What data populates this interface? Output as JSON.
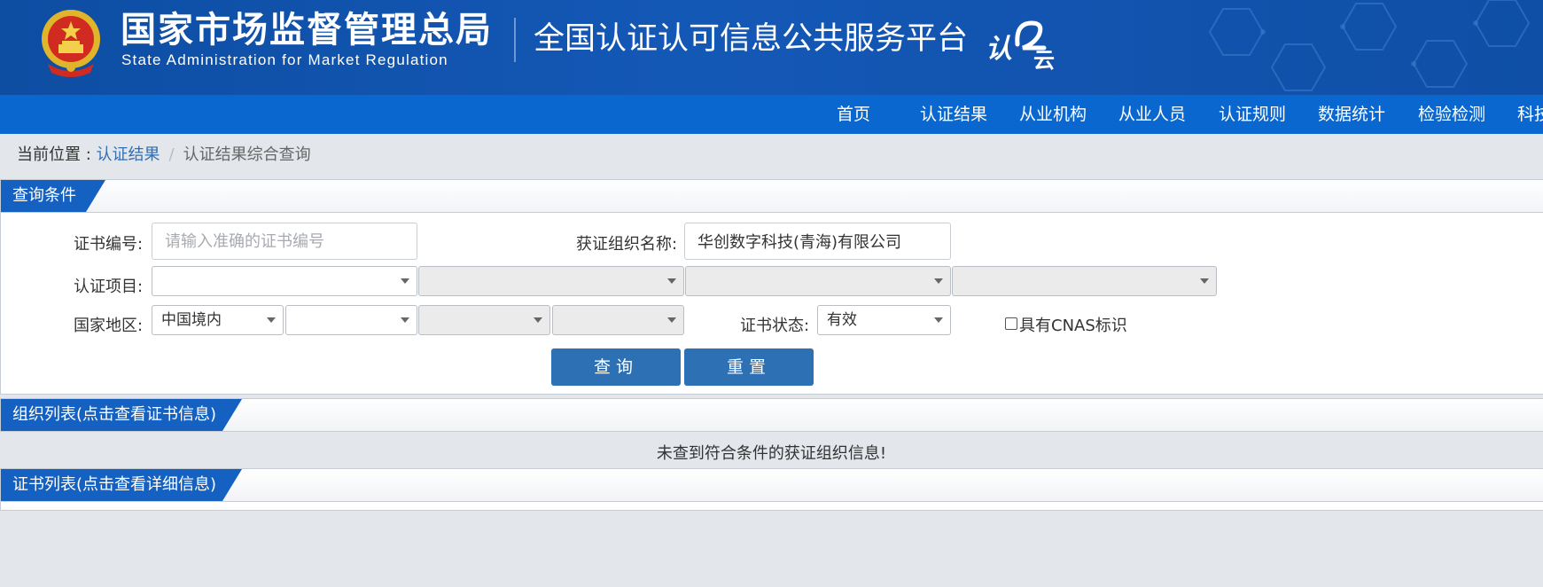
{
  "header": {
    "agency_cn": "国家市场监督管理总局",
    "agency_en": "State Administration  for  Market Regulation",
    "platform_title": "全国认证认可信息公共服务平台",
    "logo_text_main": "认",
    "logo_text_sub": "云",
    "colors": {
      "banner": "#1458b6",
      "nav": "#0a67cf",
      "tab": "#1561c1",
      "button": "#2d70b4",
      "link": "#2e6fb7"
    },
    "emblem_icon": "national-emblem"
  },
  "nav": {
    "items": [
      "首页",
      "认证结果",
      "从业机构",
      "从业人员",
      "认证规则",
      "数据统计",
      "检验检测",
      "科技"
    ]
  },
  "breadcrumb": {
    "prefix": "当前位置 : ",
    "link": "认证结果",
    "separator": "/",
    "current": "认证结果综合查询"
  },
  "query": {
    "section_title": "查询条件",
    "cert_no": {
      "label": "证书编号:",
      "value": "",
      "placeholder": "请输入准确的证书编号"
    },
    "org_name": {
      "label": "获证组织名称:",
      "value": "华创数字科技(青海)有限公司"
    },
    "cert_item": {
      "label": "认证项目:",
      "selects": [
        "",
        "",
        "",
        ""
      ]
    },
    "region": {
      "label": "国家地区:",
      "selects": [
        "中国境内",
        "",
        "",
        ""
      ]
    },
    "cert_status": {
      "label": "证书状态:",
      "value": "有效"
    },
    "cnas": {
      "label": "具有CNAS标识",
      "checked": false
    },
    "search_button": "查询",
    "reset_button": "重置"
  },
  "org_list": {
    "title": "组织列表(点击查看证书信息)",
    "empty_message": "未查到符合条件的获证组织信息!"
  },
  "cert_list": {
    "title": "证书列表(点击查看详细信息)"
  }
}
